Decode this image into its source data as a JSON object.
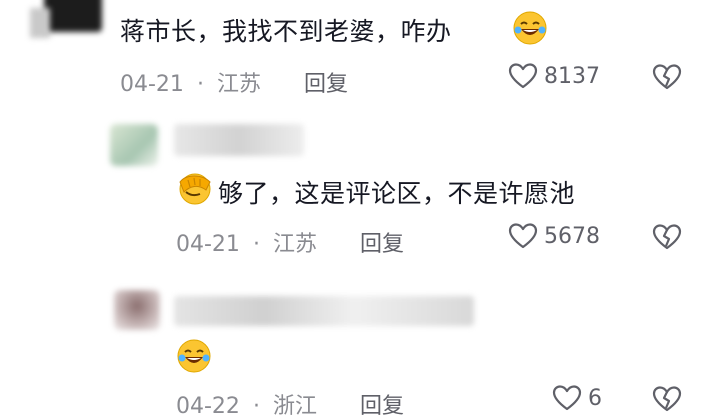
{
  "comments": [
    {
      "text": "蒋市长，我找不到老婆，咋办",
      "emoji": "rolling-on-floor-laughing",
      "date": "04-21",
      "sep": "·",
      "location": "江苏",
      "reply_label": "回复",
      "likes": "8137"
    },
    {
      "text": "够了，这是评论区，不是许愿池",
      "emoji": "facepalm",
      "date": "04-21",
      "sep": "·",
      "location": "江苏",
      "reply_label": "回复",
      "likes": "5678"
    },
    {
      "text": "",
      "emoji": "rolling-on-floor-laughing",
      "date": "04-22",
      "sep": "·",
      "location": "浙江",
      "reply_label": "回复",
      "likes": "6"
    }
  ],
  "colors": {
    "text": "#161823",
    "meta": "#8a8b91",
    "icon": "#5f6068"
  }
}
